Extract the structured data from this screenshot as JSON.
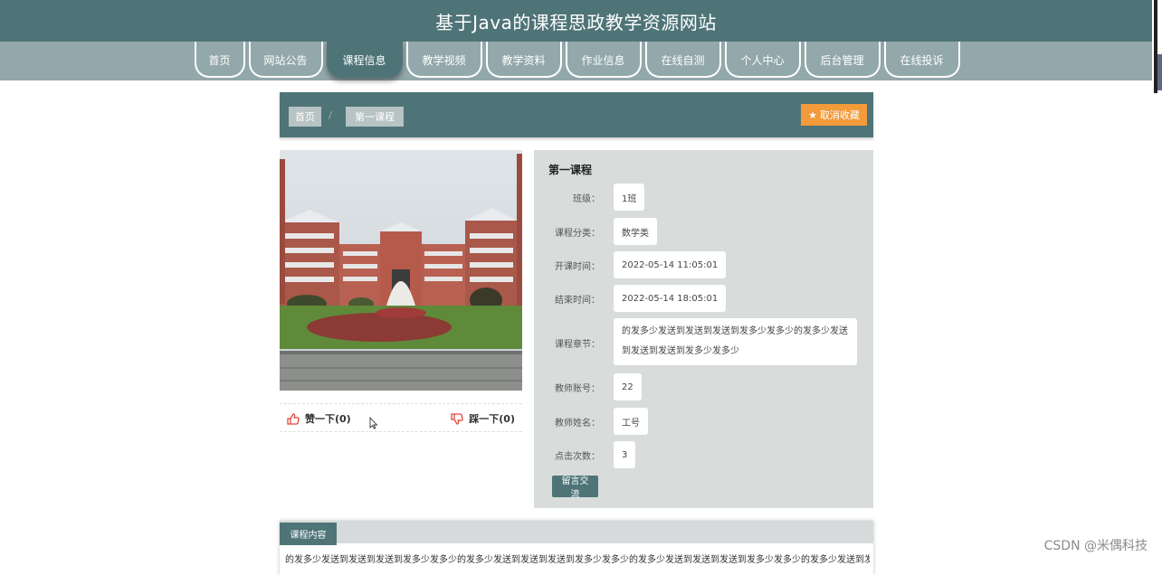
{
  "site": {
    "title": "基于Java的课程思政教学资源网站"
  },
  "nav": {
    "items": [
      {
        "label": "首页",
        "width": 56
      },
      {
        "label": "网站公告",
        "width": 82
      },
      {
        "label": "课程信息",
        "width": 84,
        "active": true
      },
      {
        "label": "教学视频",
        "width": 84
      },
      {
        "label": "教学资料",
        "width": 84
      },
      {
        "label": "作业信息",
        "width": 84
      },
      {
        "label": "在线自测",
        "width": 84
      },
      {
        "label": "个人中心",
        "width": 84
      },
      {
        "label": "后台管理",
        "width": 84
      },
      {
        "label": "在线投诉",
        "width": 84
      }
    ]
  },
  "breadcrumb": {
    "home": "首页",
    "separator": "/",
    "current": "第一课程"
  },
  "favorite": {
    "label": "取消收藏"
  },
  "votes": {
    "like": "赞一下(0)",
    "dislike": "踩一下(0)"
  },
  "detail": {
    "title": "第一课程",
    "fields": [
      {
        "label": "班级：",
        "value": "1班"
      },
      {
        "label": "课程分类：",
        "value": "数学类"
      },
      {
        "label": "开课时间：",
        "value": "2022-05-14 11:05:01"
      },
      {
        "label": "结束时间：",
        "value": "2022-05-14 18:05:01"
      },
      {
        "label": "课程章节：",
        "value": "的发多少发送到发送到发送到发多少发多少的发多少发送到发送到发送到发多少发多少"
      },
      {
        "label": "教师账号：",
        "value": "22"
      },
      {
        "label": "教师姓名：",
        "value": "工号"
      },
      {
        "label": "点击次数：",
        "value": "3"
      }
    ],
    "message_button": "留言交流"
  },
  "content": {
    "tab": "课程内容",
    "text": "的发多少发送到发送到发送到发多少发多少的发多少发送到发送到发送到发多少发多少的发多少发送到发送到发送到发多少发多少的发多少发送到发送到发送到发"
  },
  "watermark": "CSDN @米偶科技",
  "colors": {
    "primary": "#4f7478",
    "nav_bg": "#93a8aa",
    "accent": "#f39a3a",
    "panel_bg": "#d8dcdb"
  }
}
